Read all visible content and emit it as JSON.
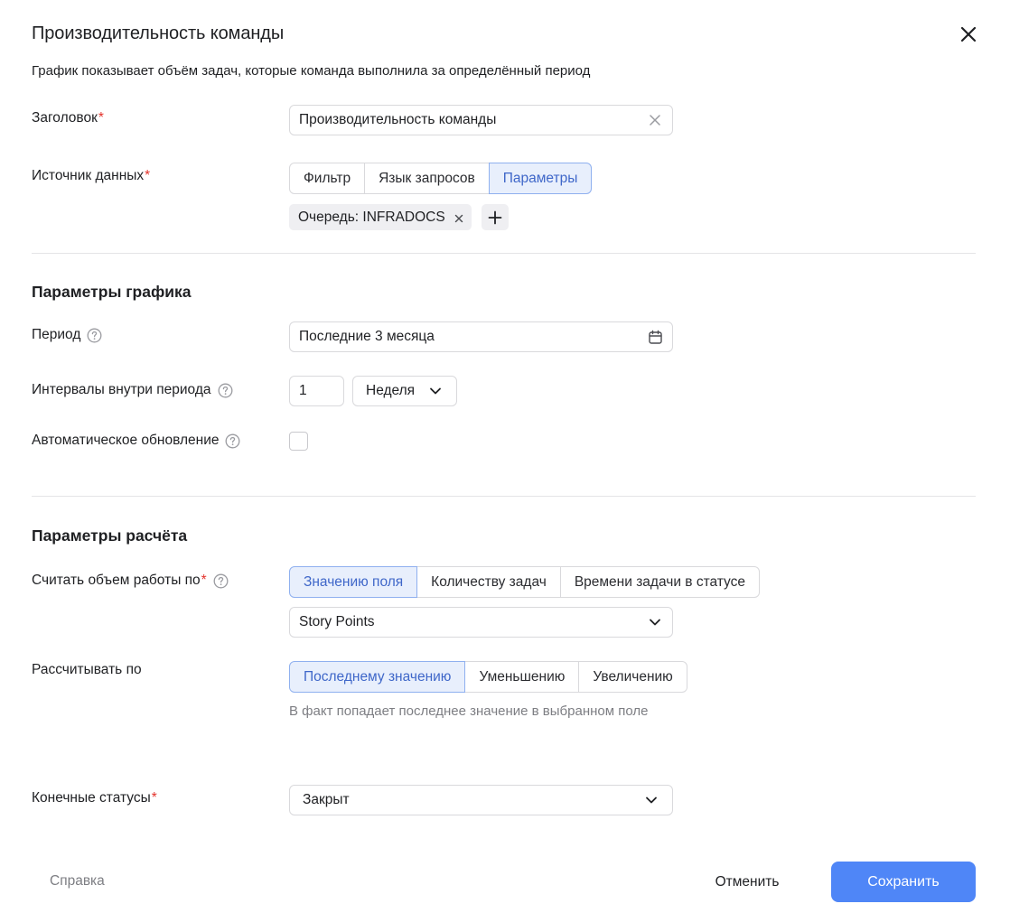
{
  "dialog": {
    "title": "Производительность команды",
    "subtitle": "График показывает объём задач, которые команда выполнила за определённый период"
  },
  "fields": {
    "header_label": "Заголовок",
    "header_value": "Производительность команды",
    "source_label": "Источник данных",
    "source_options": [
      "Фильтр",
      "Язык запросов",
      "Параметры"
    ],
    "source_selected": "Параметры",
    "chip_label": "Очередь: INFRADOCS"
  },
  "chart_params": {
    "section_title": "Параметры графика",
    "period_label": "Период",
    "period_value": "Последние 3 месяца",
    "intervals_label": "Интервалы внутри периода",
    "interval_count": "1",
    "interval_unit": "Неделя",
    "auto_update_label": "Автоматическое обновление",
    "auto_update_checked": false
  },
  "calc_params": {
    "section_title": "Параметры расчёта",
    "count_by_label": "Считать объем работы по",
    "count_by_options": [
      "Значению поля",
      "Количеству задач",
      "Времени задачи в статусе"
    ],
    "count_by_selected": "Значению поля",
    "field_value": "Story Points",
    "calc_by_label": "Рассчитывать по",
    "calc_by_options": [
      "Последнему значению",
      "Уменьшению",
      "Увеличению"
    ],
    "calc_by_selected": "Последнему значению",
    "calc_hint": "В факт попадает последнее значение в выбранном поле",
    "final_status_label": "Конечные статусы",
    "final_status_value": "Закрыт"
  },
  "footer": {
    "help": "Справка",
    "cancel": "Отменить",
    "save": "Сохранить"
  },
  "colors": {
    "accent": "#4f86f7",
    "active_segment_bg": "#e8effc",
    "active_segment_text": "#3f67c9",
    "required": "#e3322b"
  }
}
